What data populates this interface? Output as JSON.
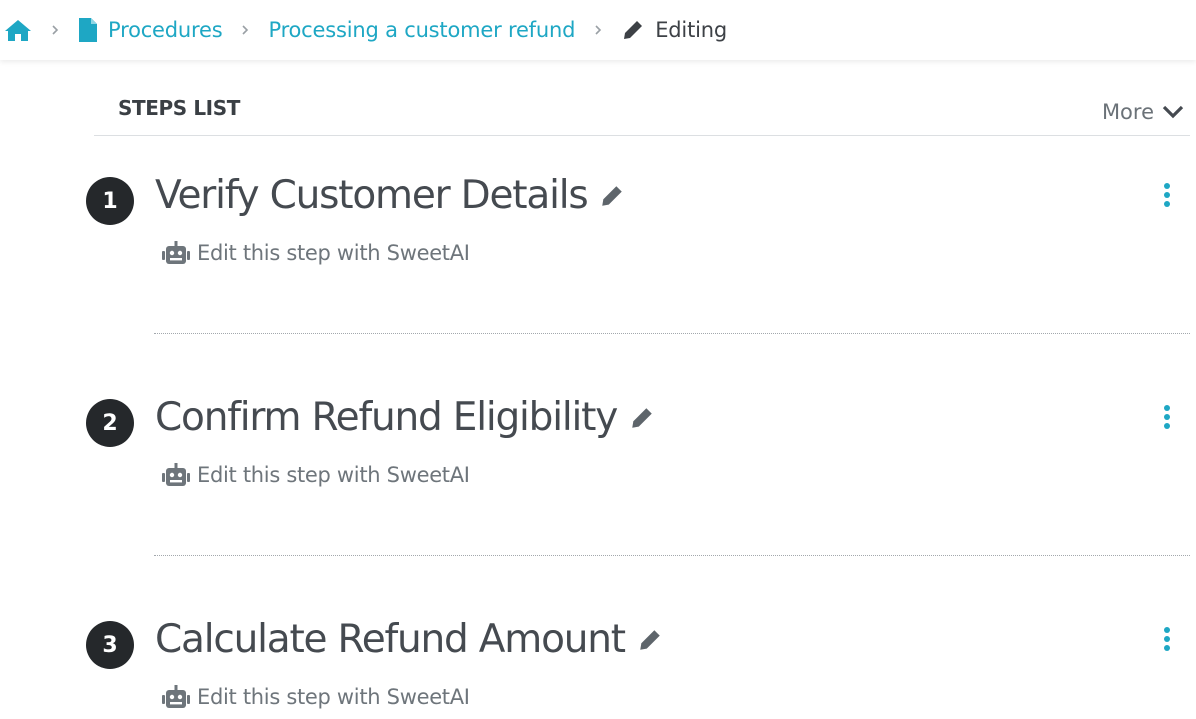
{
  "breadcrumb": {
    "home_icon": "home-icon",
    "items": [
      {
        "label": "Procedures",
        "icon": "document-icon"
      },
      {
        "label": "Processing a customer refund"
      },
      {
        "label": "Editing",
        "icon": "pencil-icon"
      }
    ]
  },
  "steps_list": {
    "title": "STEPS LIST",
    "more_label": "More"
  },
  "steps": [
    {
      "number": "1",
      "title": "Verify Customer Details",
      "ai_label": "Edit this step with SweetAI"
    },
    {
      "number": "2",
      "title": "Confirm Refund Eligibility",
      "ai_label": "Edit this step with SweetAI"
    },
    {
      "number": "3",
      "title": "Calculate Refund Amount",
      "ai_label": "Edit this step with SweetAI"
    }
  ],
  "colors": {
    "accent": "#1ea7c4",
    "step_badge": "#25282b",
    "title_text": "#454a50",
    "muted_text": "#6e757b"
  }
}
